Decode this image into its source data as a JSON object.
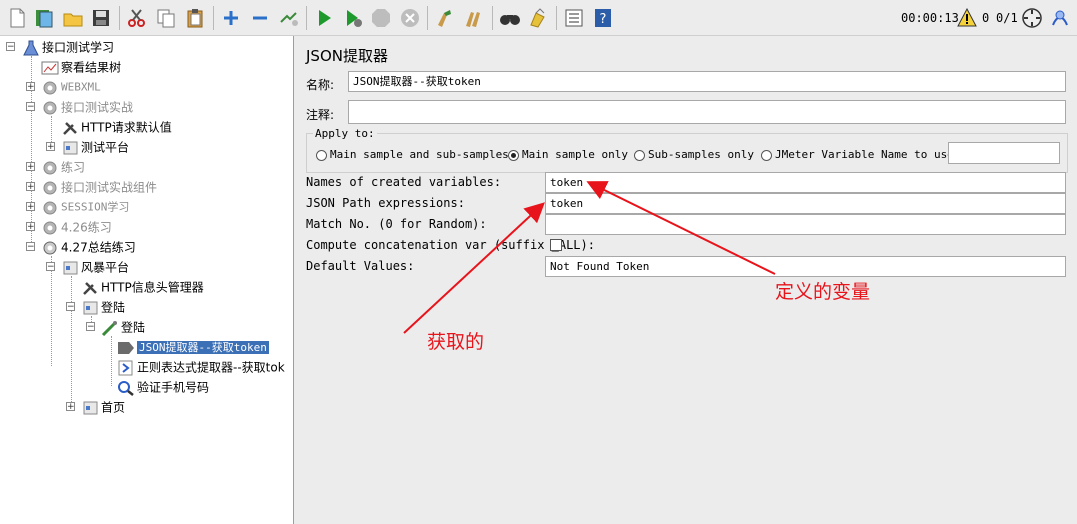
{
  "toolbar": {
    "timer": "00:00:13",
    "warning_count": "0",
    "threads": "0/1",
    "icons": [
      "new-icon",
      "templates-icon",
      "open-icon",
      "save-icon",
      "cut-icon",
      "copy-icon",
      "paste-icon",
      "expand-icon",
      "collapse-icon",
      "toggle-icon",
      "start-icon",
      "start-no-pause-icon",
      "stop-icon",
      "shutdown-icon",
      "clear-icon",
      "clear-all-icon",
      "search-icon",
      "reset-search-icon",
      "function-helper-icon",
      "help-icon",
      "warning-icon",
      "remote-icon",
      "log-icon"
    ]
  },
  "tree": {
    "items": [
      {
        "label": "接口测试学习",
        "icon": "test-plan-icon"
      },
      {
        "label": "察看结果树",
        "icon": "listener-icon"
      },
      {
        "label": "WEBXML",
        "icon": "thread-group-icon"
      },
      {
        "label": "接口测试实战",
        "icon": "thread-group-icon"
      },
      {
        "label": "HTTP请求默认值",
        "icon": "config-icon"
      },
      {
        "label": "测试平台",
        "icon": "controller-icon"
      },
      {
        "label": "练习",
        "icon": "thread-group-icon"
      },
      {
        "label": "接口测试实战组件",
        "icon": "thread-group-icon"
      },
      {
        "label": "SESSION学习",
        "icon": "thread-group-icon"
      },
      {
        "label": "4.26练习",
        "icon": "thread-group-icon"
      },
      {
        "label": "4.27总结练习",
        "icon": "thread-group-icon"
      },
      {
        "label": "风暴平台",
        "icon": "controller-icon"
      },
      {
        "label": "HTTP信息头管理器",
        "icon": "config-icon"
      },
      {
        "label": "登陆",
        "icon": "controller-icon"
      },
      {
        "label": "登陆",
        "icon": "sampler-icon"
      },
      {
        "label": "JSON提取器--获取token",
        "icon": "extractor-icon"
      },
      {
        "label": "正则表达式提取器--获取tok",
        "icon": "extractor-icon"
      },
      {
        "label": "验证手机号码",
        "icon": "assertion-icon"
      },
      {
        "label": "首页",
        "icon": "controller-icon"
      }
    ]
  },
  "panel": {
    "title": "JSON提取器",
    "name_label": "名称:",
    "name_value": "JSON提取器--获取token",
    "comment_label": "注释:",
    "comment_value": "",
    "apply_to": {
      "legend": "Apply to:",
      "options": [
        "Main sample and sub-samples",
        "Main sample only",
        "Sub-samples only",
        "JMeter Variable Name to use"
      ],
      "selected": "Main sample only",
      "variable_value": ""
    },
    "fields": {
      "names_label": "Names of created variables:",
      "names_value": "token",
      "path_label": "JSON Path expressions:",
      "path_value": "token",
      "match_label": "Match No. (0 for Random):",
      "match_value": "",
      "concat_label": "Compute concatenation var (suffix _ALL):",
      "concat_checked": false,
      "default_label": "Default Values:",
      "default_value": "Not Found Token"
    }
  },
  "annotations": {
    "defined_variable": "定义的变量",
    "obtained": "获取的",
    "color": "#e8141c"
  },
  "colors": {
    "selection": "#3b6fb6",
    "background": "#ececec"
  }
}
